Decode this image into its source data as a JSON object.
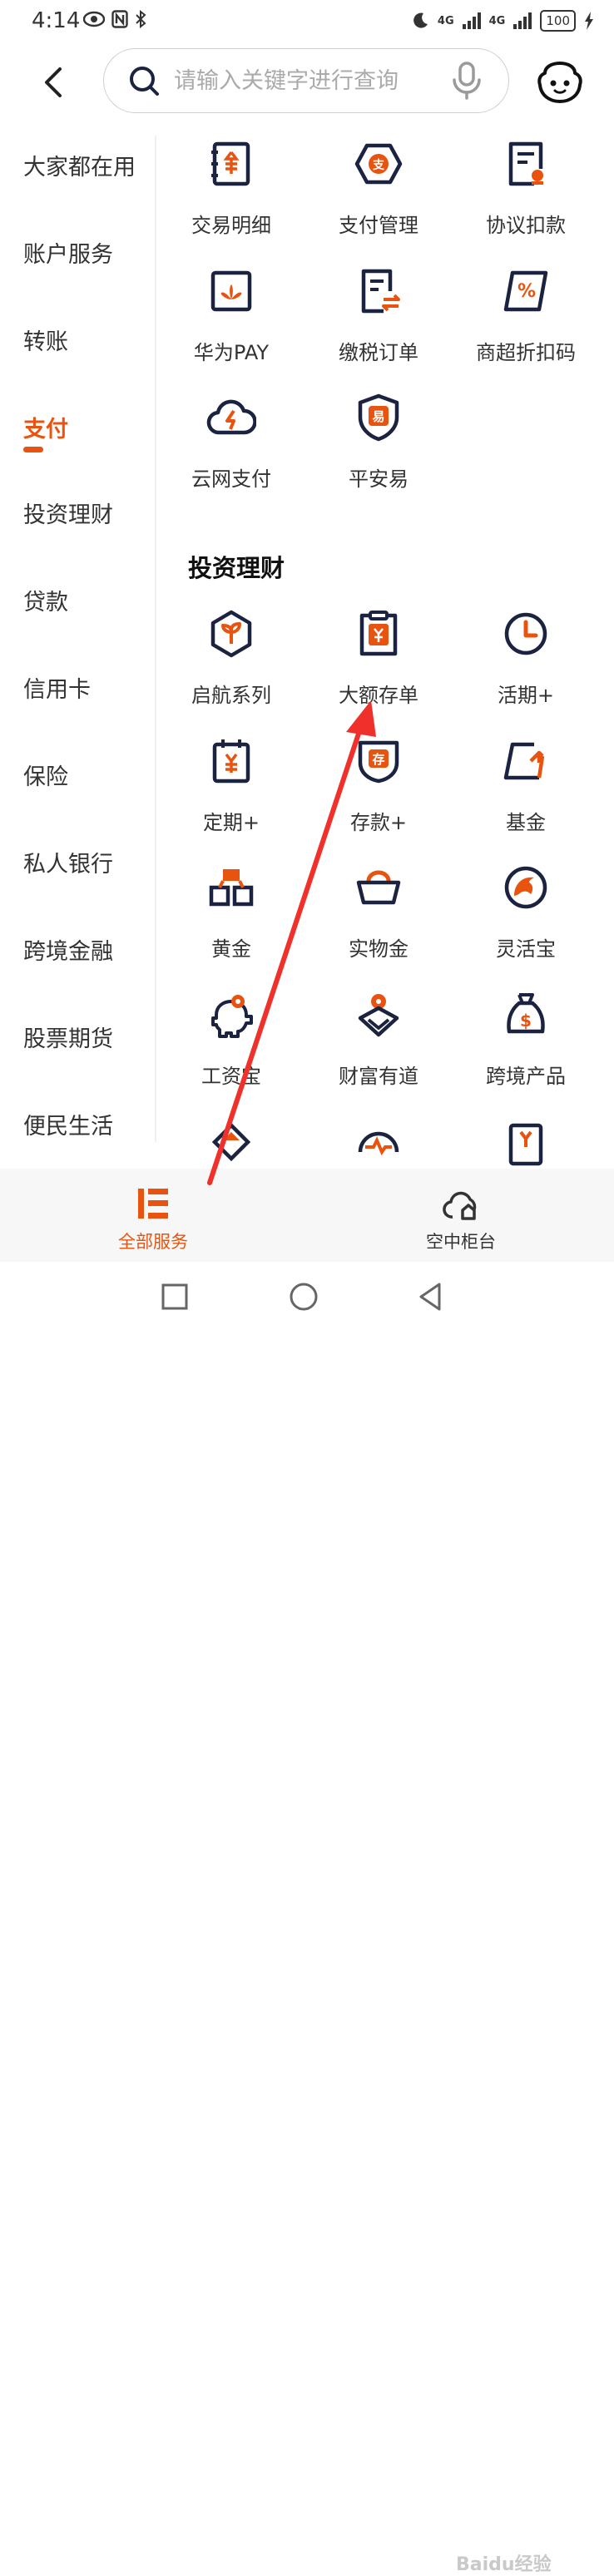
{
  "status_bar": {
    "time": "4:14",
    "battery": "100",
    "network1": "4G",
    "network2": "4G"
  },
  "search": {
    "placeholder": "请输入关键字进行查询"
  },
  "sidebar": {
    "items": [
      {
        "label": "大家都在用"
      },
      {
        "label": "账户服务"
      },
      {
        "label": "转账"
      },
      {
        "label": "支付"
      },
      {
        "label": "投资理财"
      },
      {
        "label": "贷款"
      },
      {
        "label": "信用卡"
      },
      {
        "label": "保险"
      },
      {
        "label": "私人银行"
      },
      {
        "label": "跨境金融"
      },
      {
        "label": "股票期货"
      },
      {
        "label": "便民生活"
      }
    ],
    "active_index": 3
  },
  "payment_services": [
    {
      "label": "交易明细",
      "icon": "ledger-yuan-icon"
    },
    {
      "label": "支付管理",
      "icon": "payment-hexagon-icon"
    },
    {
      "label": "协议扣款",
      "icon": "agreement-document-icon"
    },
    {
      "label": "华为PAY",
      "icon": "huawei-pay-icon"
    },
    {
      "label": "缴税订单",
      "icon": "tax-order-icon"
    },
    {
      "label": "商超折扣码",
      "icon": "discount-code-icon"
    },
    {
      "label": "云网支付",
      "icon": "cloud-payment-icon"
    },
    {
      "label": "平安易",
      "icon": "pingan-yi-shield-icon"
    }
  ],
  "investment": {
    "title": "投资理财",
    "items": [
      {
        "label": "启航系列",
        "icon": "sprout-hexagon-icon"
      },
      {
        "label": "大额存单",
        "icon": "large-deposit-clipboard-icon"
      },
      {
        "label": "活期+",
        "icon": "clock-icon"
      },
      {
        "label": "定期+",
        "icon": "fixed-term-calendar-icon"
      },
      {
        "label": "存款+",
        "icon": "deposit-shield-icon"
      },
      {
        "label": "基金",
        "icon": "fund-chart-icon"
      },
      {
        "label": "黄金",
        "icon": "gold-bars-icon"
      },
      {
        "label": "实物金",
        "icon": "gold-ingot-icon"
      },
      {
        "label": "灵活宝",
        "icon": "dolphin-icon"
      },
      {
        "label": "工资宝",
        "icon": "piggy-bank-icon"
      },
      {
        "label": "财富有道",
        "icon": "wealth-diamond-icon"
      },
      {
        "label": "跨境产品",
        "icon": "money-bag-icon"
      }
    ]
  },
  "bottom_nav": [
    {
      "label": "全部服务",
      "icon": "all-services-icon",
      "active": true
    },
    {
      "label": "空中柜台",
      "icon": "cloud-home-icon",
      "active": false
    }
  ],
  "watermark": "Baidu经验",
  "colors": {
    "accent": "#e8540f",
    "icon_dark": "#1c2340",
    "text": "#333333"
  }
}
